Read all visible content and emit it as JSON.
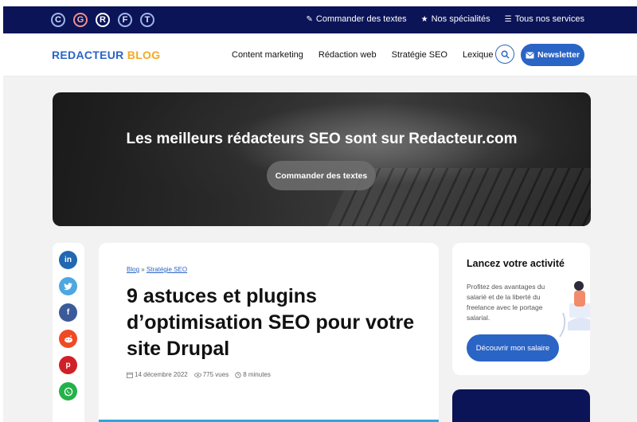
{
  "topbar": {
    "brands": [
      {
        "letter": "C",
        "icon": "brand-c-icon"
      },
      {
        "letter": "G",
        "icon": "brand-g-icon"
      },
      {
        "letter": "R",
        "icon": "brand-r-icon"
      },
      {
        "letter": "F",
        "icon": "brand-f-icon"
      },
      {
        "letter": "T",
        "icon": "brand-t-icon"
      }
    ],
    "links": [
      {
        "icon": "pencil-icon",
        "glyph": "✎",
        "label": "Commander des textes"
      },
      {
        "icon": "star-icon",
        "glyph": "★",
        "label": "Nos spécialités"
      },
      {
        "icon": "menu-icon",
        "glyph": "☰",
        "label": "Tous nos services"
      }
    ]
  },
  "nav": {
    "logo_part1": "REDACTEUR",
    "logo_part2": "BLOG",
    "links": [
      "Content marketing",
      "Rédaction web",
      "Stratégie SEO",
      "Lexique"
    ],
    "search_icon": "search-icon",
    "newsletter_label": "Newsletter",
    "newsletter_icon": "envelope-icon"
  },
  "hero": {
    "title": "Les meilleurs rédacteurs SEO sont sur Redacteur.com",
    "button_label": "Commander des textes"
  },
  "share": [
    {
      "name": "linkedin",
      "glyph": "in",
      "color": "#2167b2"
    },
    {
      "name": "twitter",
      "glyph": "t",
      "color": "#4da7e0"
    },
    {
      "name": "facebook",
      "glyph": "f",
      "color": "#3b5a9a"
    },
    {
      "name": "reddit",
      "glyph": "r",
      "color": "#ef4a24"
    },
    {
      "name": "pinterest",
      "glyph": "p",
      "color": "#d02028"
    },
    {
      "name": "whatsapp",
      "glyph": "w",
      "color": "#24b14a"
    }
  ],
  "article": {
    "breadcrumb": {
      "home": "Blog",
      "separator": "»",
      "category": "Stratégie SEO"
    },
    "title": "9 astuces et plugins d’optimisation SEO pour votre site Drupal",
    "date": "14 décembre 2022",
    "views": "775 vues",
    "read_time": "8 minutes"
  },
  "sidebar_card": {
    "title": "Lancez votre activité",
    "text": "Profitez des avantages du salarié et de la liberté du freelance avec le portage salarial.",
    "button_label": "Découvrir mon salaire"
  },
  "colors": {
    "topbar": "#0b1457",
    "primary": "#2a64c5",
    "accent": "#f3a925",
    "background": "#f2f2f2"
  }
}
